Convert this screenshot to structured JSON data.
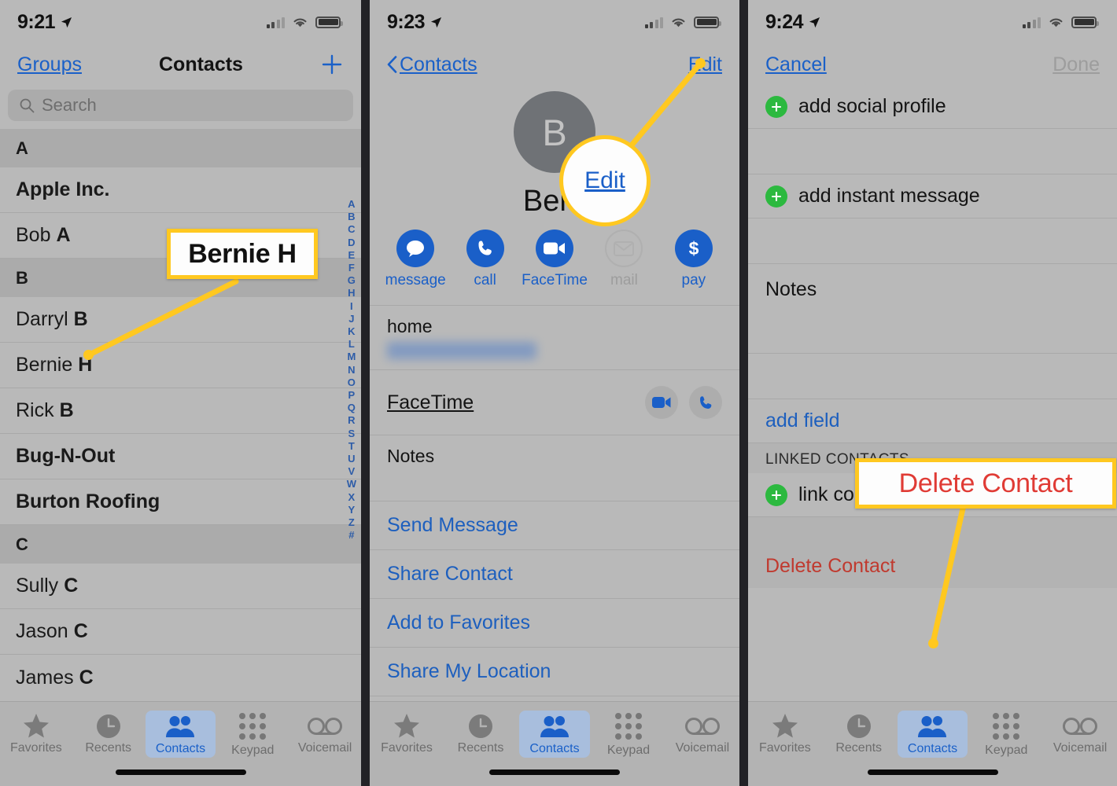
{
  "panels": [
    {
      "status": {
        "time": "9:21",
        "location_icon": "location-arrow-icon",
        "signal_icon": "cellular-signal-icon",
        "wifi_icon": "wifi-icon",
        "battery_icon": "battery-icon"
      },
      "nav": {
        "left": "Groups",
        "title": "Contacts",
        "right_icon": "plus-icon"
      },
      "search": {
        "placeholder": "Search",
        "icon": "search-icon"
      },
      "sections": [
        {
          "header": "A",
          "rows": [
            {
              "first": "Apple Inc.",
              "last": "",
              "bold": true
            },
            {
              "first": "Bob",
              "last": "A",
              "bold": false
            }
          ]
        },
        {
          "header": "B",
          "rows": [
            {
              "first": "Darryl",
              "last": "B",
              "bold": false
            },
            {
              "first": "Bernie",
              "last": "H",
              "bold": false
            },
            {
              "first": "Rick",
              "last": "B",
              "bold": false
            },
            {
              "first": "Bug-N-Out",
              "last": "",
              "bold": true
            },
            {
              "first": "Burton Roofing",
              "last": "",
              "bold": true
            }
          ]
        },
        {
          "header": "C",
          "rows": [
            {
              "first": "Sully",
              "last": "C",
              "bold": false
            },
            {
              "first": "Jason",
              "last": "C",
              "bold": false
            },
            {
              "first": "James",
              "last": "C",
              "bold": false
            }
          ]
        }
      ],
      "alphabet_index": [
        "A",
        "B",
        "C",
        "D",
        "E",
        "F",
        "G",
        "H",
        "I",
        "J",
        "K",
        "L",
        "M",
        "N",
        "O",
        "P",
        "Q",
        "R",
        "S",
        "T",
        "U",
        "V",
        "W",
        "X",
        "Y",
        "Z",
        "#"
      ],
      "callout": {
        "text": "Bernie H",
        "style": "box-black"
      }
    },
    {
      "status": {
        "time": "9:23"
      },
      "nav": {
        "back_label": "Contacts",
        "right": "Edit"
      },
      "contact": {
        "avatar_initial": "B",
        "name": "Bern"
      },
      "actions": [
        {
          "label": "message",
          "icon": "message-bubble-icon",
          "disabled": false
        },
        {
          "label": "call",
          "icon": "phone-icon",
          "disabled": false
        },
        {
          "label": "FaceTime",
          "icon": "video-camera-icon",
          "disabled": false
        },
        {
          "label": "mail",
          "icon": "envelope-icon",
          "disabled": true
        },
        {
          "label": "pay",
          "icon": "dollar-sign-icon",
          "disabled": false
        }
      ],
      "fields": [
        {
          "label": "home",
          "value_redacted": true
        },
        {
          "label": "FaceTime",
          "type": "facetime",
          "buttons": [
            "video-camera-icon",
            "phone-icon"
          ]
        },
        {
          "label": "Notes",
          "type": "notes"
        }
      ],
      "links": [
        "Send Message",
        "Share Contact",
        "Add to Favorites",
        "Share My Location"
      ],
      "callout": {
        "text": "Edit",
        "style": "circle-blue"
      }
    },
    {
      "status": {
        "time": "9:24"
      },
      "nav": {
        "left": "Cancel",
        "right": "Done",
        "right_disabled": true
      },
      "rows": [
        {
          "type": "add",
          "label": "add social profile",
          "icon": "plus-circle-green-icon"
        },
        {
          "type": "blank"
        },
        {
          "type": "add",
          "label": "add instant message",
          "icon": "plus-circle-green-icon"
        },
        {
          "type": "blank"
        },
        {
          "type": "notes",
          "label": "Notes"
        },
        {
          "type": "blank"
        },
        {
          "type": "link",
          "label": "add field"
        }
      ],
      "linked_section": {
        "caption": "LINKED CONTACTS",
        "link_label": "link contacts...",
        "icon": "plus-circle-green-icon"
      },
      "delete_label": "Delete Contact",
      "callout": {
        "text": "Delete Contact",
        "style": "box-red"
      }
    }
  ],
  "tabbar": {
    "tabs": [
      {
        "label": "Favorites",
        "icon": "star-icon",
        "selected": false
      },
      {
        "label": "Recents",
        "icon": "clock-icon",
        "selected": false
      },
      {
        "label": "Contacts",
        "icon": "people-icon",
        "selected": true
      },
      {
        "label": "Keypad",
        "icon": "keypad-dots-icon",
        "selected": false
      },
      {
        "label": "Voicemail",
        "icon": "voicemail-icon",
        "selected": false
      }
    ]
  },
  "colors": {
    "accent_blue": "#1a5fc8",
    "callout_yellow": "#ffc820",
    "delete_red": "#c03a2f",
    "add_green": "#2cb93f",
    "screen_bg": "#b9b9b9"
  }
}
